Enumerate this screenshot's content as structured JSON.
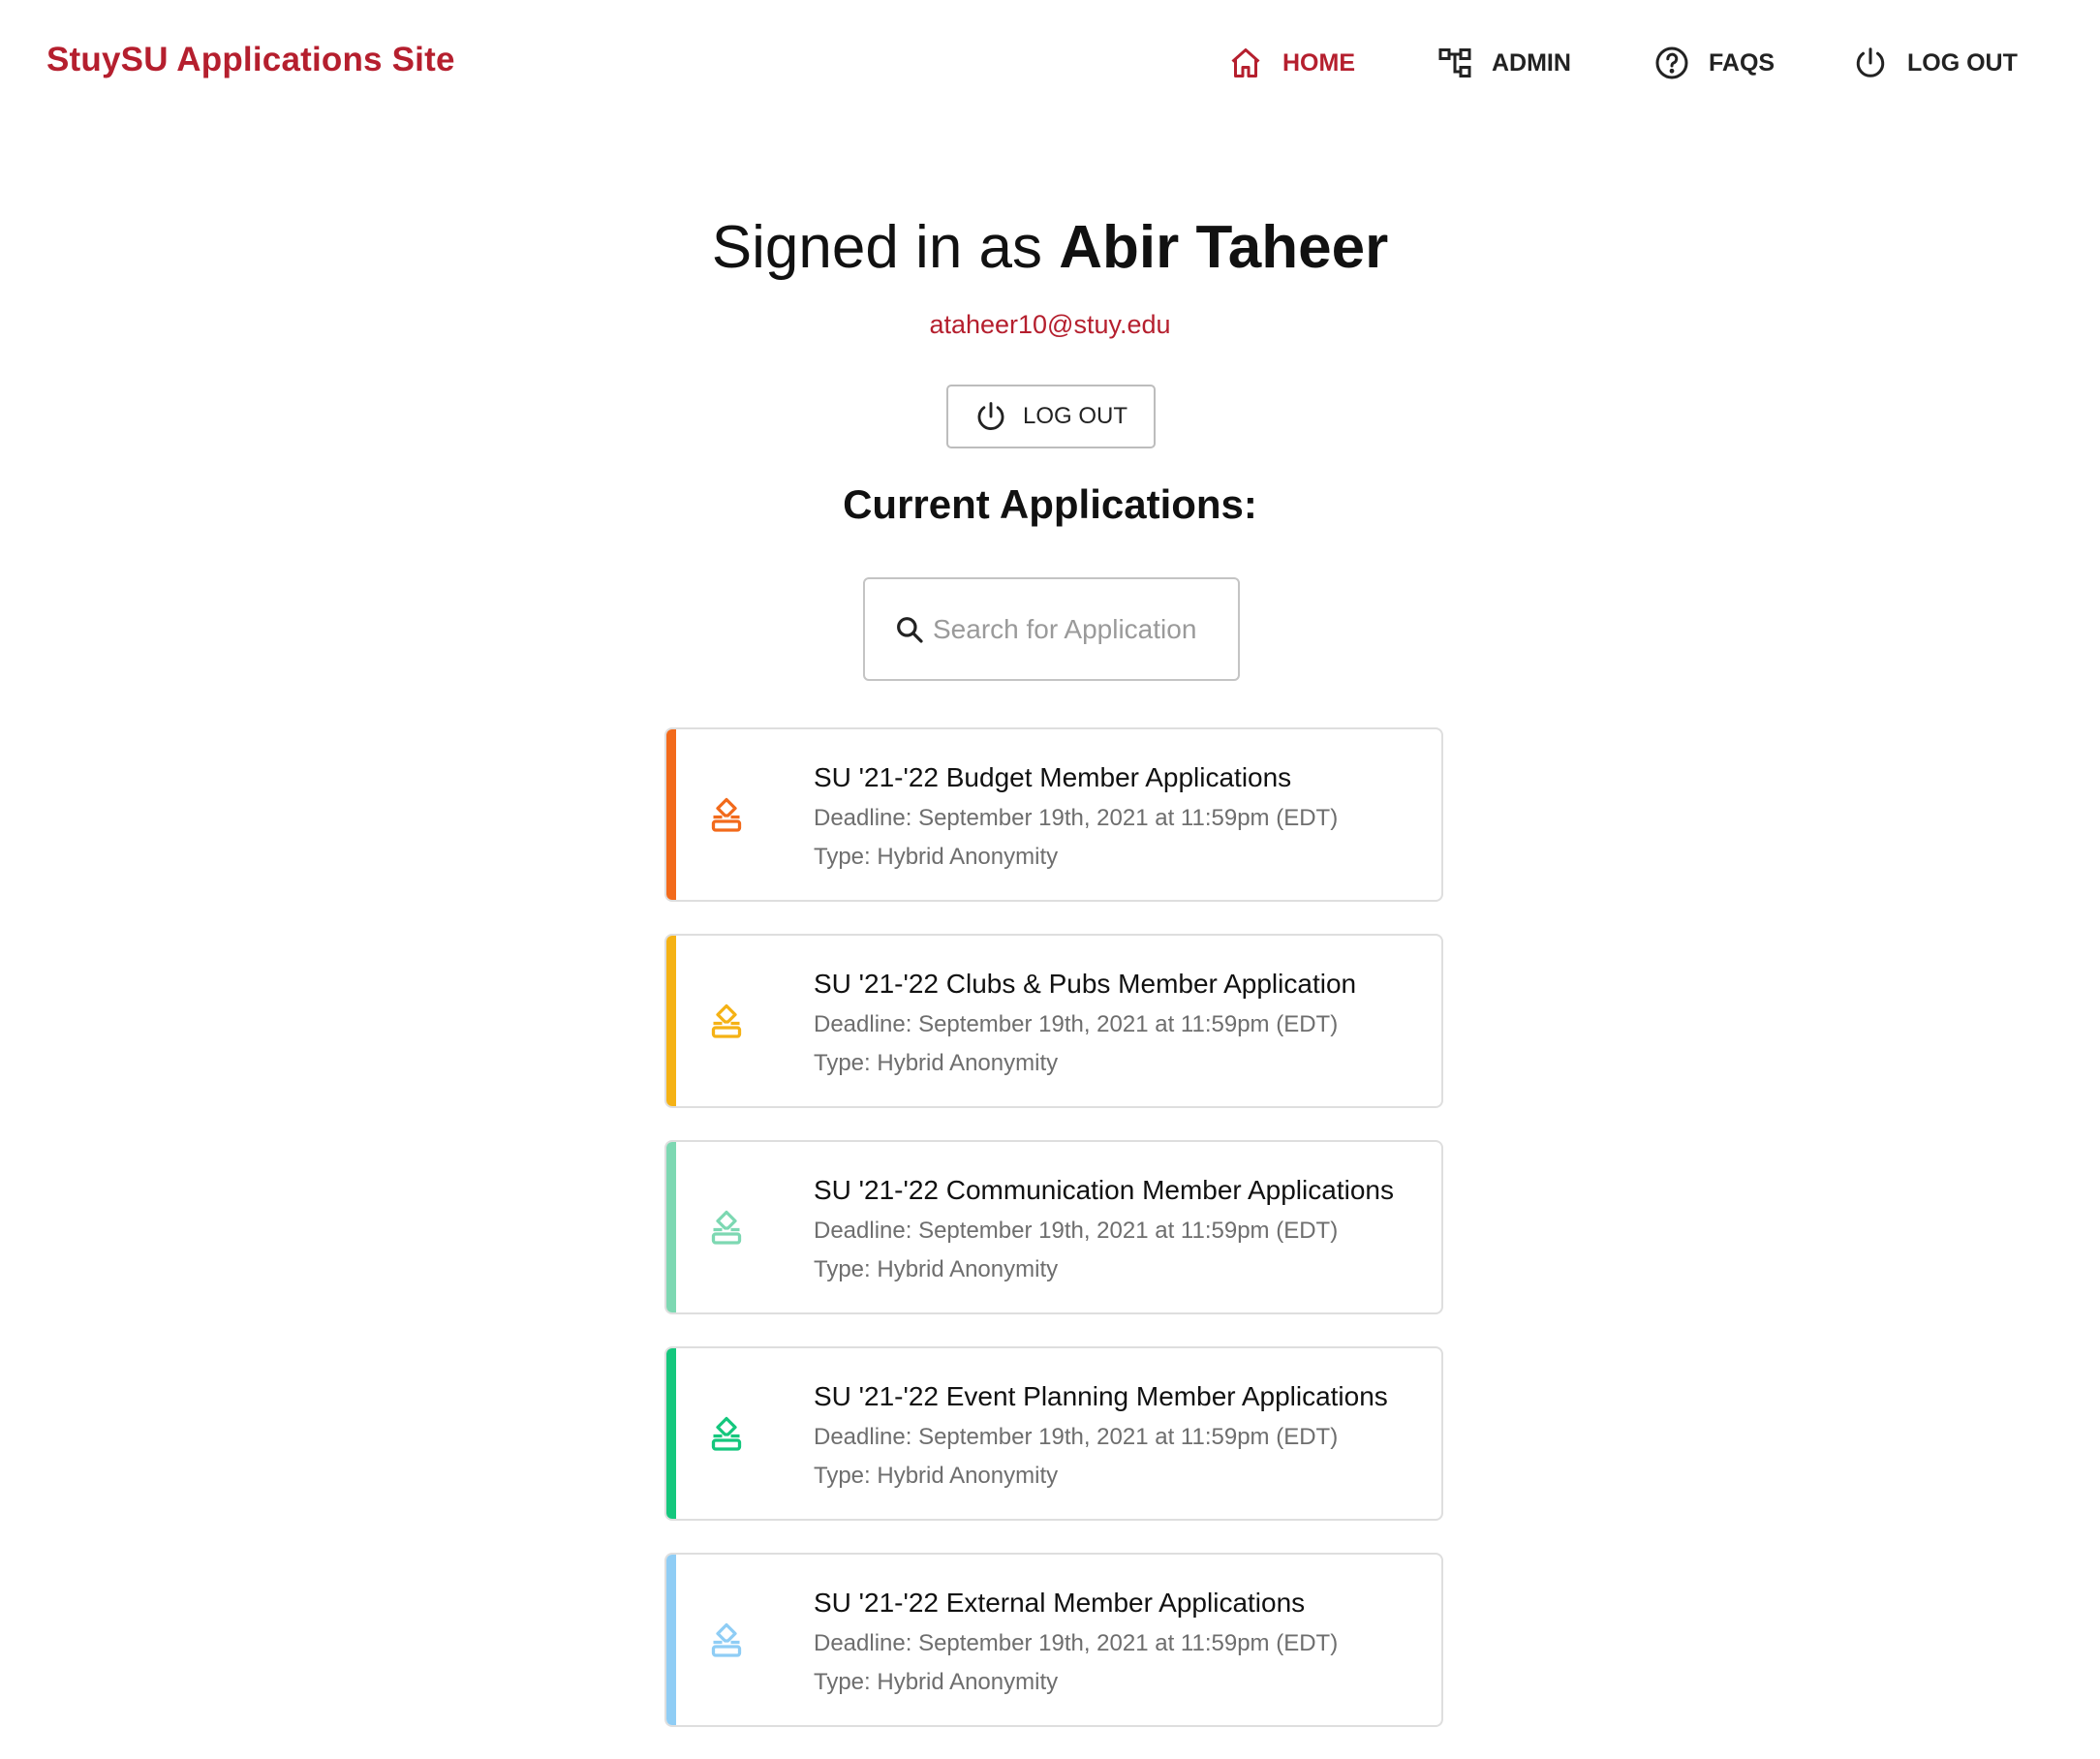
{
  "brand": "StuySU Applications Site",
  "nav": {
    "home": "HOME",
    "admin": "ADMIN",
    "faqs": "FAQS",
    "logout": "LOG OUT"
  },
  "account": {
    "signed_in_prefix": "Signed in as",
    "name": "Abir Taheer",
    "email": "ataheer10@stuy.edu",
    "logout_label": "LOG OUT"
  },
  "section_title": "Current Applications:",
  "search": {
    "placeholder": "Search for Application",
    "value": ""
  },
  "colors": {
    "brand": "#b51f2e",
    "card_accents": [
      "#f26a1b",
      "#f5b215",
      "#7dd8b2",
      "#14c77d",
      "#8fcdf5"
    ]
  },
  "applications": [
    {
      "title": "SU '21-'22 Budget Member Applications",
      "deadline": "Deadline: September 19th, 2021 at 11:59pm (EDT)",
      "type": "Type: Hybrid Anonymity",
      "icon": "ballot-box-icon",
      "color": "#f26a1b"
    },
    {
      "title": "SU '21-'22 Clubs & Pubs Member Application",
      "deadline": "Deadline: September 19th, 2021 at 11:59pm (EDT)",
      "type": "Type: Hybrid Anonymity",
      "icon": "ballot-box-icon",
      "color": "#f5b215"
    },
    {
      "title": "SU '21-'22 Communication Member Applications",
      "deadline": "Deadline: September 19th, 2021 at 11:59pm (EDT)",
      "type": "Type: Hybrid Anonymity",
      "icon": "ballot-box-icon",
      "color": "#7dd8b2"
    },
    {
      "title": "SU '21-'22 Event Planning Member Applications",
      "deadline": "Deadline: September 19th, 2021 at 11:59pm (EDT)",
      "type": "Type: Hybrid Anonymity",
      "icon": "ballot-box-icon",
      "color": "#14c77d"
    },
    {
      "title": "SU '21-'22 External Member Applications",
      "deadline": "Deadline: September 19th, 2021 at 11:59pm (EDT)",
      "type": "Type: Hybrid Anonymity",
      "icon": "ballot-box-icon",
      "color": "#8fcdf5"
    }
  ]
}
